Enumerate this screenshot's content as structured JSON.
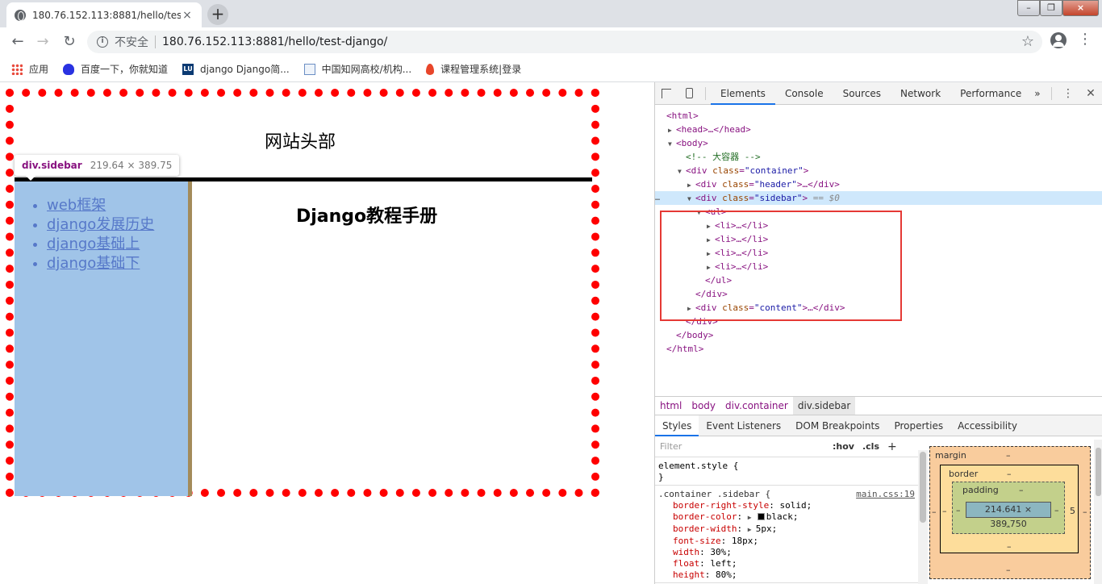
{
  "browser": {
    "tab_title": "180.76.152.113:8881/hello/tes",
    "tab_close": "×",
    "new_tab": "+",
    "win_min": "–",
    "win_max": "❐",
    "win_close": "×",
    "back": "←",
    "forward": "→",
    "reload": "↻",
    "insecure_label": "不安全",
    "info_glyph": "i",
    "url": "180.76.152.113:8881/hello/test-django/",
    "star": "☆",
    "menu": "⋮",
    "bookmarks": [
      "应用",
      "百度一下，你就知道",
      "django Django简...",
      "中国知网高校/机构...",
      "课程管理系统|登录"
    ],
    "lu_glyph": "LU"
  },
  "page": {
    "header_title": "网站头部",
    "sidebar_items": [
      "web框架",
      "django发展历史",
      "django基础上",
      "django基础下"
    ],
    "content_title": "Django教程手册",
    "tooltip_tag": "div.sidebar",
    "tooltip_size": "219.64 × 389.75"
  },
  "devtools": {
    "tabs": [
      "Elements",
      "Console",
      "Sources",
      "Network",
      "Performance",
      "»"
    ],
    "more": "⋮",
    "close": "✕",
    "tree": {
      "html_open": "<html>",
      "head": "<head>…</head>",
      "body_open": "<body>",
      "comment": "<!-- 大容器 -->",
      "container_tag": "<div ",
      "container_attr": "class",
      "container_val": "\"container\"",
      "header_tag": "<div ",
      "header_attr": "class",
      "header_val": "\"header\"",
      "header_close": "…</div>",
      "sidebar_tag": "<div ",
      "sidebar_attr": "class",
      "sidebar_val": "\"sidebar\"",
      "sidebar_eq": "== $0",
      "ul_open": "<ul>",
      "li": "<li>…</li>",
      "ul_close": "</ul>",
      "div_close": "</div>",
      "content_tag": "<div ",
      "content_attr": "class",
      "content_val": "\"content\"",
      "content_close": "…</div>",
      "body_close": "</body>",
      "html_close": "</html>",
      "ellipsis": "…"
    },
    "breadcrumbs": [
      "html",
      "body",
      "div.container",
      "div.sidebar"
    ],
    "subtabs": [
      "Styles",
      "Event Listeners",
      "DOM Breakpoints",
      "Properties",
      "Accessibility"
    ],
    "filter_placeholder": "Filter",
    "hov": ":hov",
    "cls": ".cls",
    "plus": "+",
    "element_style": "element.style {",
    "close_brace": "}",
    "rule_selector": ".container .sidebar {",
    "rule_source": "main.css:19",
    "props": [
      {
        "name": "border-right-style",
        "value": "solid;"
      },
      {
        "name": "border-color",
        "value": "black;"
      },
      {
        "name": "border-width",
        "value": "5px;"
      },
      {
        "name": "font-size",
        "value": "18px;"
      },
      {
        "name": "width",
        "value": "30%;"
      },
      {
        "name": "float",
        "value": "left;"
      },
      {
        "name": "height",
        "value": "80%;"
      }
    ],
    "boxmodel": {
      "margin": "margin",
      "border": "border",
      "padding": "padding",
      "dash": "–",
      "content": "214.641 × 389.750",
      "border_right": "5"
    }
  }
}
